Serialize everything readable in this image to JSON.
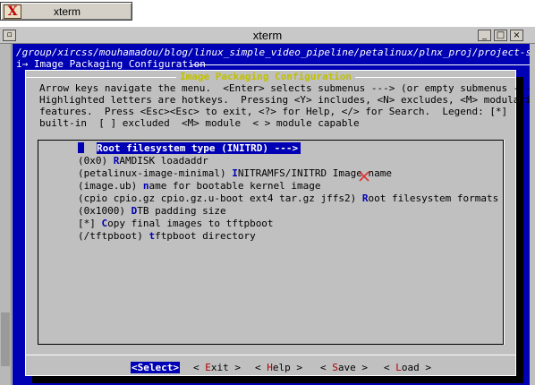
{
  "taskbar": {
    "task_label": "xterm",
    "task_icon_glyph": "X"
  },
  "window": {
    "title": "xterm",
    "menu_button": "▫",
    "minimize": "_",
    "maximize": "□",
    "close": "×"
  },
  "terminal": {
    "path": "/group/xircss/mouhamadou/blog/linux_simple_video_pipeline/petalinux/plnx_proj/project-spec/conf",
    "breadcrumb": "i→ Image Packaging Configuration"
  },
  "dialog": {
    "title": "Image Packaging Configuration",
    "help_lines": [
      "Arrow keys navigate the menu.  <Enter> selects submenus ---> (or empty submenus ----).",
      "Highlighted letters are hotkeys.  Pressing <Y> includes, <N> excludes, <M> modularizes",
      "features.  Press <Esc><Esc> to exit, <?> for Help, </> for Search.  Legend: [*]",
      "built-in  [ ] excluded  <M> module  < > module capable"
    ],
    "items": [
      {
        "pre": "",
        "hot": "R",
        "post": "oot filesystem type (INITRD)  --->",
        "selected": true
      },
      {
        "pre": "(0x0) ",
        "hot": "R",
        "post": "AMDISK loadaddr"
      },
      {
        "pre": "(petalinux-image-minimal) ",
        "hot": "I",
        "post": "NITRAMFS/INITRD Image name"
      },
      {
        "pre": "(image.ub) ",
        "hot": "n",
        "post": "ame for bootable kernel image"
      },
      {
        "pre": "(cpio cpio.gz cpio.gz.u-boot ext4 tar.gz jffs2) ",
        "hot": "R",
        "post": "oot filesystem formats"
      },
      {
        "pre": "(0x1000) ",
        "hot": "D",
        "post": "TB padding size"
      },
      {
        "pre": "[*] ",
        "hot": "C",
        "post": "opy final images to tftpboot"
      },
      {
        "pre": "(/tftpboot) ",
        "hot": "t",
        "post": "ftpboot directory"
      }
    ],
    "buttons": [
      {
        "lb": "<",
        "hk": "S",
        "rest": "elect",
        "rb": ">",
        "active": true
      },
      {
        "lb": "< ",
        "hk": "E",
        "rest": "xit",
        "rb": " >"
      },
      {
        "lb": "< ",
        "hk": "H",
        "rest": "elp",
        "rb": " >"
      },
      {
        "lb": "< ",
        "hk": "S",
        "rest": "ave",
        "rb": " >"
      },
      {
        "lb": "< ",
        "hk": "L",
        "rest": "oad",
        "rb": " >"
      }
    ]
  },
  "colors": {
    "terminal_bg": "#0000b4",
    "dialog_bg": "#c0c0c0",
    "hotkey_blue": "#0000b4",
    "button_hotkey_red": "#b00000",
    "title_yellow": "#c0c000",
    "cross_red": "#e03030"
  },
  "icons": {
    "cross": "x-mark-icon"
  }
}
